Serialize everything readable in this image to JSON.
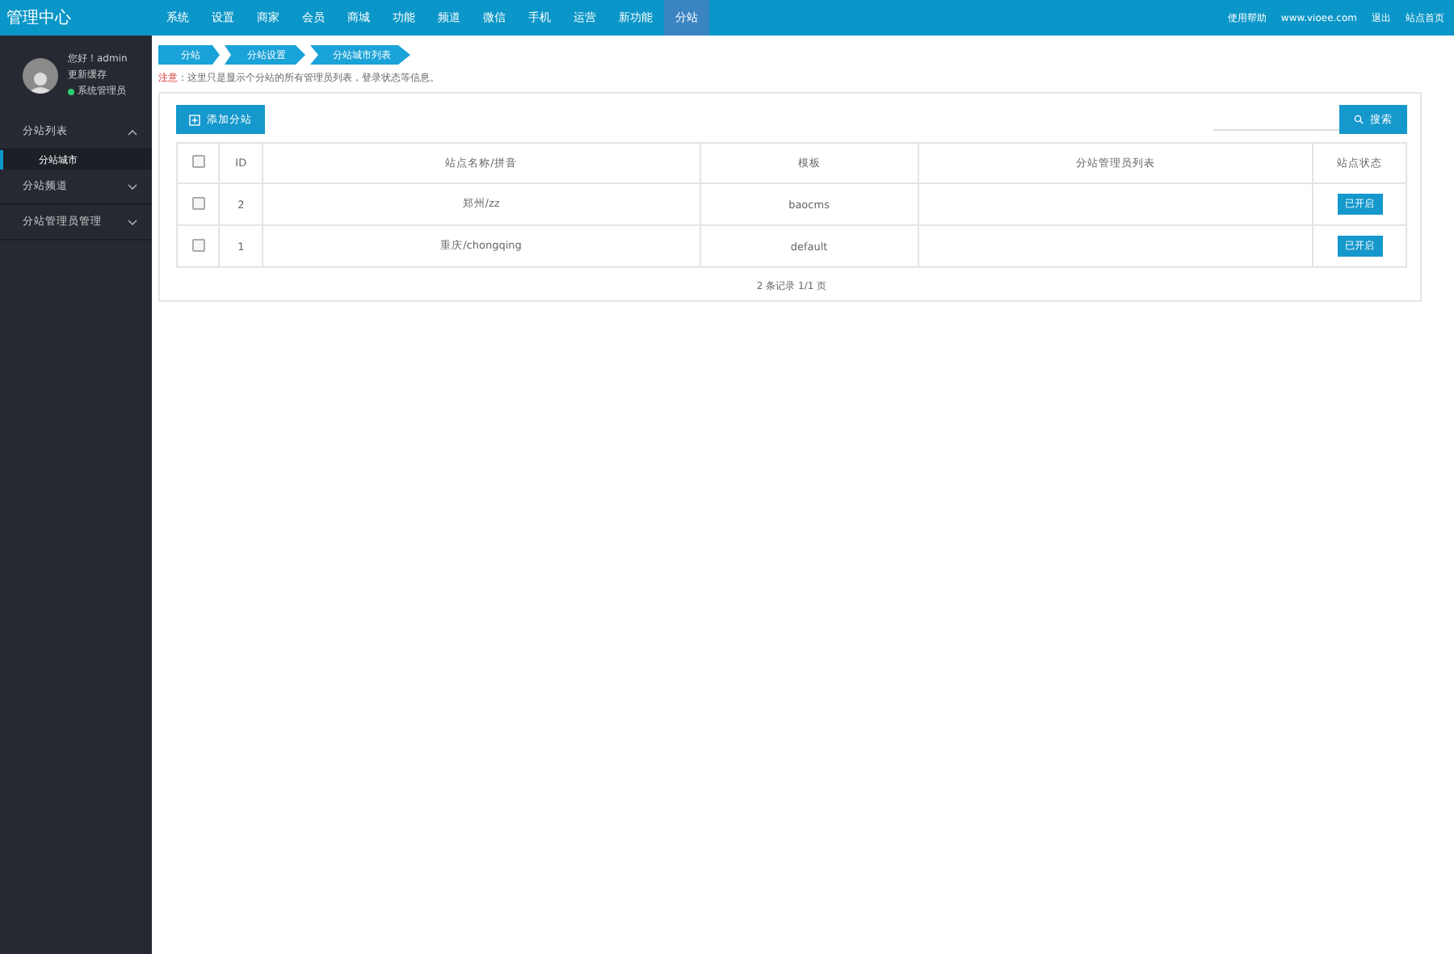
{
  "header": {
    "title": "管理中心",
    "nav": [
      {
        "label": "系统",
        "selected": false
      },
      {
        "label": "设置",
        "selected": false
      },
      {
        "label": "商家",
        "selected": false
      },
      {
        "label": "会员",
        "selected": false
      },
      {
        "label": "商城",
        "selected": false
      },
      {
        "label": "功能",
        "selected": false
      },
      {
        "label": "频道",
        "selected": false
      },
      {
        "label": "微信",
        "selected": false
      },
      {
        "label": "手机",
        "selected": false
      },
      {
        "label": "运营",
        "selected": false
      },
      {
        "label": "新功能",
        "selected": false
      },
      {
        "label": "分站",
        "selected": true
      }
    ],
    "links": [
      "使用帮助",
      "www.vioee.com",
      "退出",
      "站点首页"
    ]
  },
  "user": {
    "greeting": "您好！admin",
    "action": "更新缓存",
    "role": "系统管理员"
  },
  "sidebar": {
    "items": [
      {
        "label": "分站列表",
        "expanded": true,
        "children": [
          {
            "label": "分站城市",
            "selected": true
          }
        ]
      },
      {
        "label": "分站频道",
        "expanded": false
      },
      {
        "label": "分站管理员管理",
        "expanded": false
      }
    ]
  },
  "breadcrumb": [
    "分站",
    "分站设置",
    "分站城市列表"
  ],
  "notice": {
    "label": "注意",
    "text": "：这里只是显示个分站的所有管理员列表，登录状态等信息。"
  },
  "toolbar": {
    "add_button": "添加分站",
    "search_button": "搜索"
  },
  "table": {
    "select_all_checked": false,
    "columns": [
      "ID",
      "站点名称/拼音",
      "模板",
      "分站管理员列表",
      "站点状态"
    ],
    "rows": [
      {
        "checked": false,
        "id": "2",
        "name": "郑州/zz",
        "template": "baocms",
        "status": "已开启"
      },
      {
        "checked": false,
        "id": "1",
        "name": "重庆/chongqing",
        "template": "default",
        "status": "已开启"
      }
    ]
  },
  "pagination": "2 条记录 1/1 页"
}
